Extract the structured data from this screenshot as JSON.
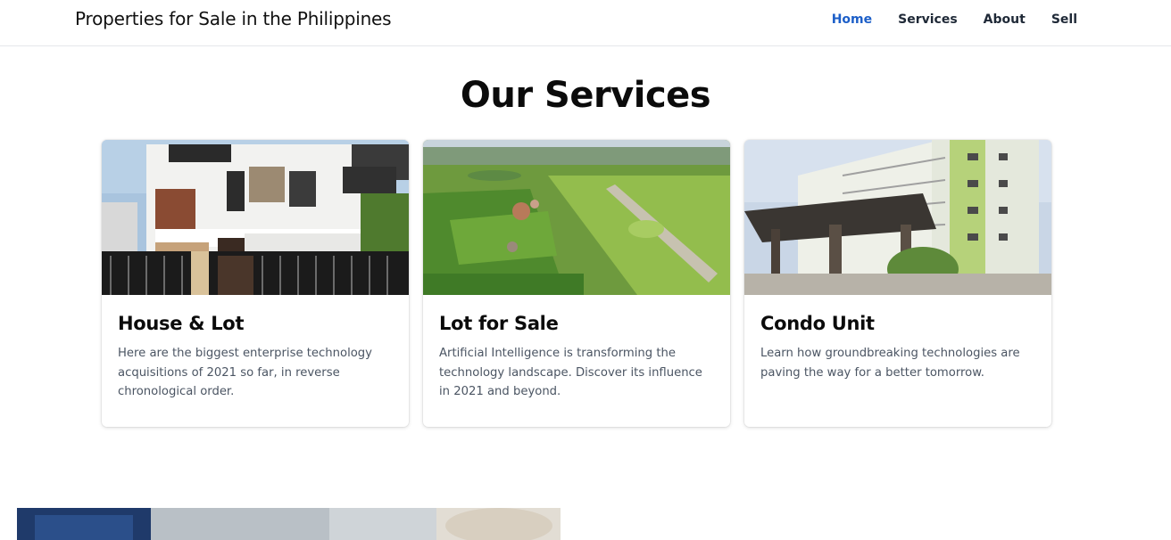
{
  "navbar": {
    "brand": "Properties for Sale in the Philippines",
    "items": [
      {
        "label": "Home",
        "active": true
      },
      {
        "label": "Services",
        "active": false
      },
      {
        "label": "About",
        "active": false
      },
      {
        "label": "Sell",
        "active": false
      }
    ]
  },
  "section": {
    "title": "Our Services"
  },
  "cards": [
    {
      "title": "House & Lot",
      "text": "Here are the biggest enterprise technology acquisitions of 2021 so far, in reverse chronological order."
    },
    {
      "title": "Lot for Sale",
      "text": "Artificial Intelligence is transforming the technology landscape. Discover its influence in 2021 and beyond."
    },
    {
      "title": "Condo Unit",
      "text": "Learn how groundbreaking technologies are paving the way for a better tomorrow."
    }
  ],
  "colors": {
    "accent": "#1d5fc8",
    "text": "#111827",
    "muted": "#4b5563"
  }
}
